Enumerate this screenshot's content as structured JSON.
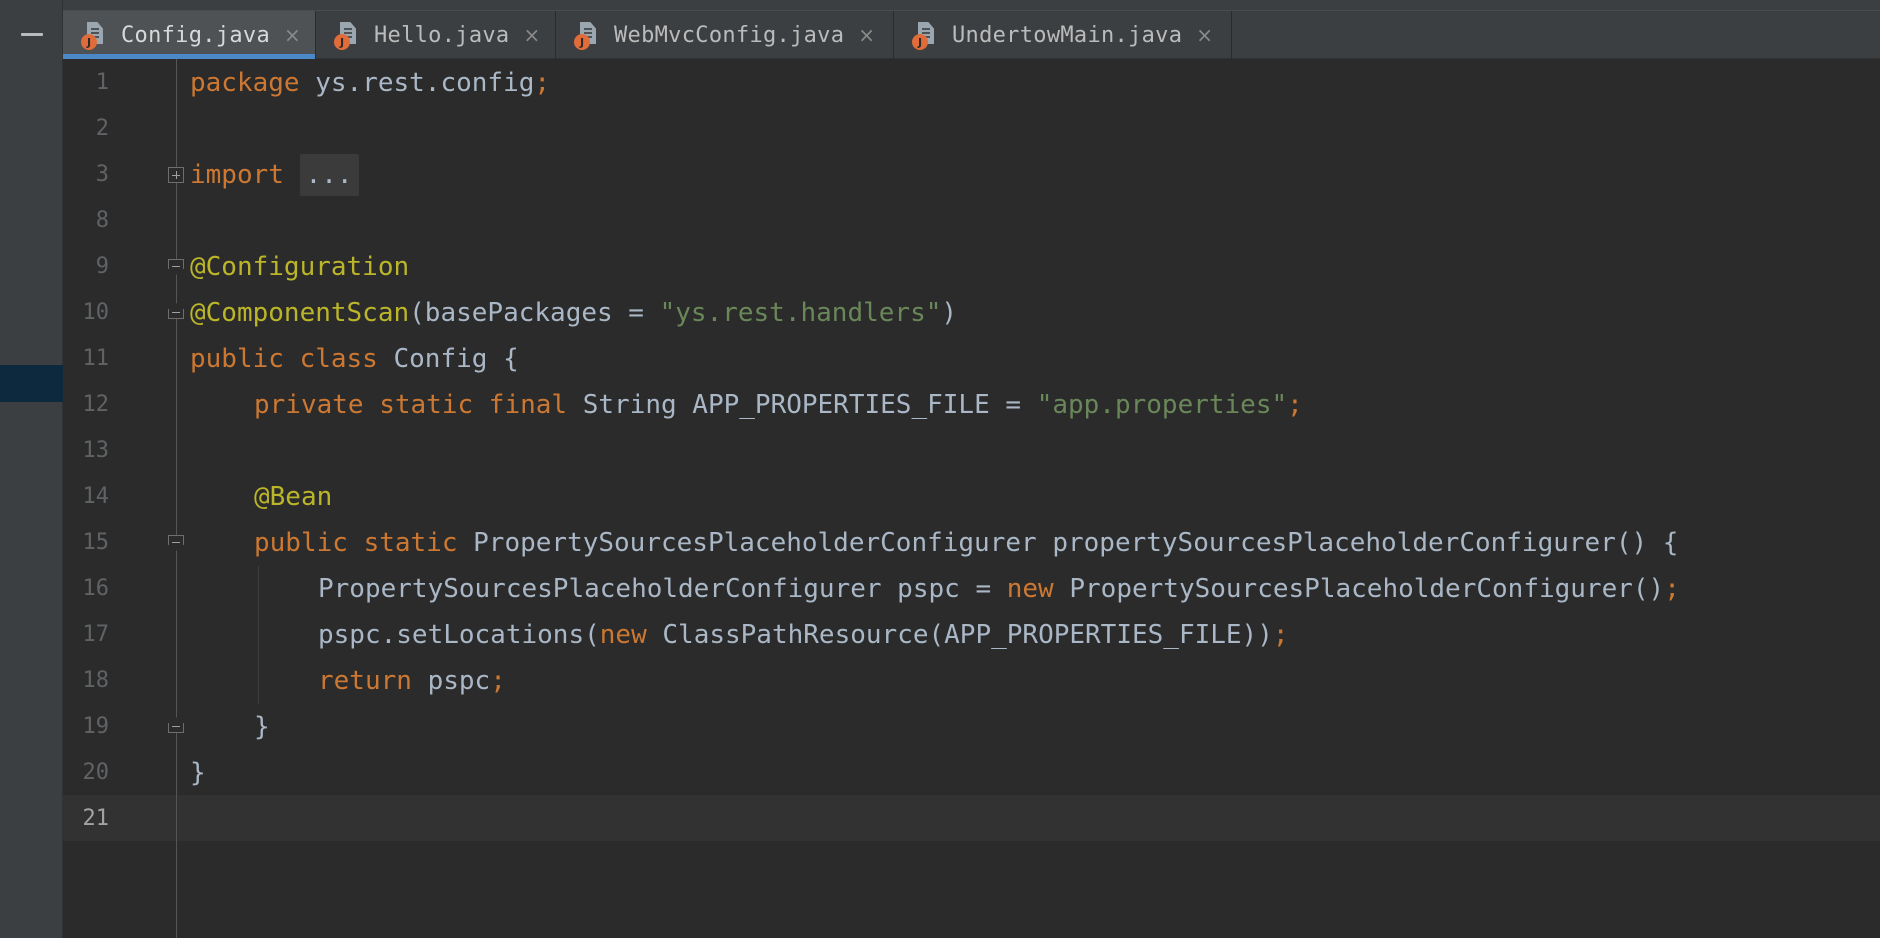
{
  "tabs": [
    {
      "name": "Config.java",
      "active": true
    },
    {
      "name": "Hello.java",
      "active": false
    },
    {
      "name": "WebMvcConfig.java",
      "active": false
    },
    {
      "name": "UndertowMain.java",
      "active": false
    }
  ],
  "tab_close_glyph": "×",
  "file_icon_badge": "J",
  "line_numbers": [
    "1",
    "2",
    "3",
    "8",
    "9",
    "10",
    "11",
    "12",
    "13",
    "14",
    "15",
    "16",
    "17",
    "18",
    "19",
    "20",
    "21"
  ],
  "current_line": "21",
  "code": {
    "l1_kw": "package",
    "l1_rest": " ys.rest.config",
    "l1_semi": ";",
    "l3_kw": "import",
    "l3_fold": "...",
    "l9_ann": "@Configuration",
    "l10_ann": "@ComponentScan",
    "l10_a": "(basePackages = ",
    "l10_str": "\"ys.rest.handlers\"",
    "l10_b": ")",
    "l11_kw": "public class",
    "l11_rest": " Config {",
    "l12_kw": "private static final",
    "l12_rest": " String APP_PROPERTIES_FILE = ",
    "l12_str": "\"app.properties\"",
    "l12_semi": ";",
    "l14_ann": "@Bean",
    "l15_kw": "public static",
    "l15_rest": " PropertySourcesPlaceholderConfigurer propertySourcesPlaceholderConfigurer() {",
    "l16_a": "PropertySourcesPlaceholderConfigurer pspc = ",
    "l16_kw": "new",
    "l16_b": " PropertySourcesPlaceholderConfigurer()",
    "l16_semi": ";",
    "l17_a": "pspc.setLocations(",
    "l17_kw": "new",
    "l17_b": " ClassPathResource(APP_PROPERTIES_FILE))",
    "l17_semi": ";",
    "l18_kw": "return",
    "l18_rest": " pspc",
    "l18_semi": ";",
    "l19": "}",
    "l20": "}"
  },
  "colors": {
    "background": "#2b2b2b",
    "keyword": "#cc7832",
    "string": "#6a8759",
    "annotation": "#bbb529",
    "text": "#a9b7c6",
    "active_tab_underline": "#4a88c7"
  }
}
